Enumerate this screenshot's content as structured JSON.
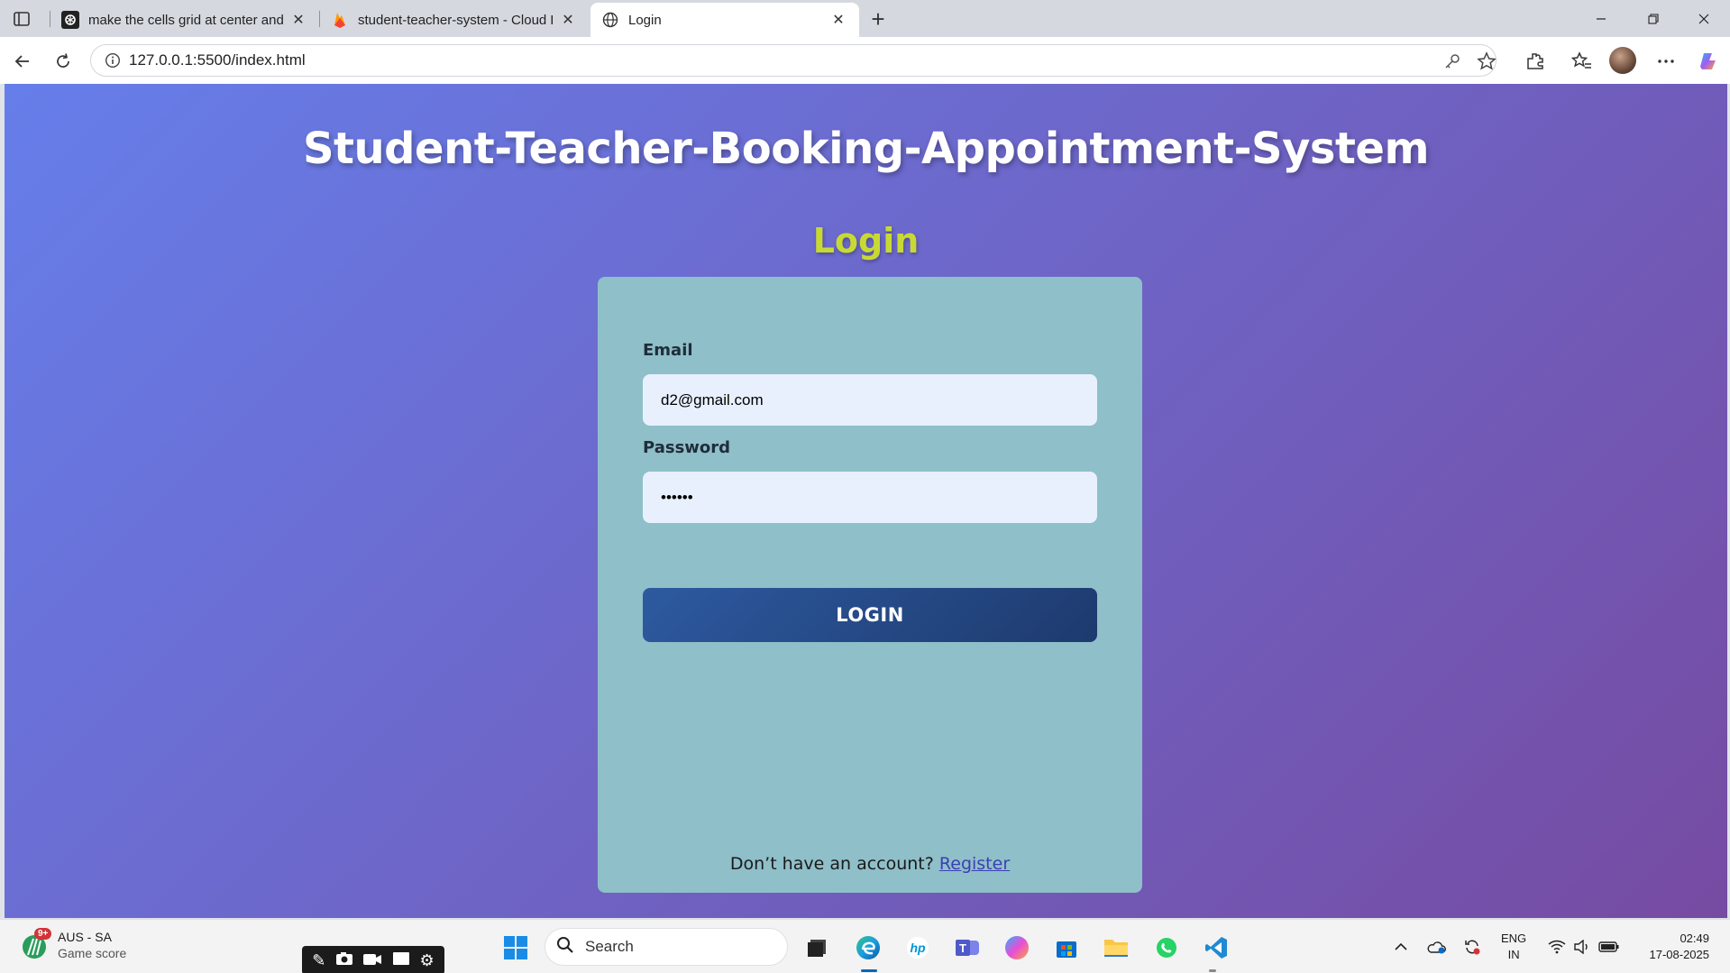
{
  "browser": {
    "tabs": [
      {
        "title": "make the cells grid at center and t",
        "active": false
      },
      {
        "title": "student-teacher-system - Cloud F",
        "active": false
      },
      {
        "title": "Login",
        "active": true
      }
    ],
    "new_tab_label": "+",
    "address": "127.0.0.1:5500/index.html"
  },
  "page": {
    "site_title": "Student-Teacher-Booking-Appointment-System",
    "heading": "Login",
    "email_label": "Email",
    "email_value": "d2@gmail.com",
    "password_label": "Password",
    "password_value": "••••••",
    "login_button": "LOGIN",
    "register_prompt": "Don’t have an account?",
    "register_link": "Register"
  },
  "taskbar": {
    "weather_badge": "9+",
    "weather_title": "AUS - SA",
    "weather_sub": "Game score",
    "search_placeholder": "Search",
    "lang_line1": "ENG",
    "lang_line2": "IN",
    "time": "02:49",
    "date": "17-08-2025"
  },
  "colors": {
    "gradient_start": "#667eea",
    "gradient_end": "#764ba2",
    "card": "#8fbfc9",
    "heading": "#c8d934",
    "button": "#2d5aa0"
  }
}
